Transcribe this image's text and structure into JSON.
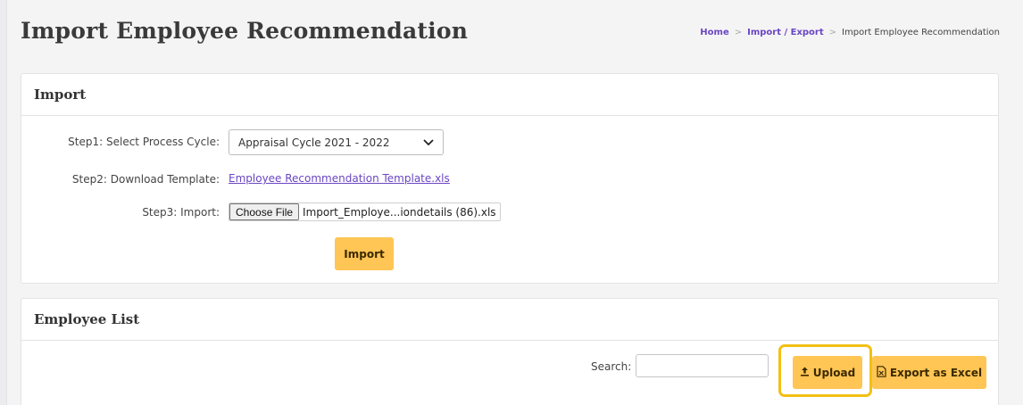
{
  "header": {
    "title": "Import Employee Recommendation",
    "breadcrumb": {
      "home": "Home",
      "sep": ">",
      "section": "Import / Export",
      "current": "Import Employee Recommendation"
    }
  },
  "import_card": {
    "title": "Import",
    "step1_label": "Step1: Select Process Cycle:",
    "step1_value": "Appraisal Cycle 2021 - 2022",
    "step2_label": "Step2: Download Template:",
    "step2_link": "Employee Recommendation Template.xls",
    "step3_label": "Step3: Import:",
    "file_button": "Choose File",
    "file_name": "Import_Employe...iondetails (86).xls",
    "import_button": "Import"
  },
  "list_card": {
    "title": "Employee List",
    "search_label": "Search:",
    "search_value": "",
    "upload_button": "Upload",
    "export_button": "Export as Excel"
  },
  "icons": {
    "chevron": "chevron-down-icon",
    "upload": "upload-icon",
    "excel": "excel-file-icon"
  },
  "colors": {
    "accent_button": "#ffc555",
    "link": "#6a46c2",
    "highlight": "#f2c014"
  }
}
